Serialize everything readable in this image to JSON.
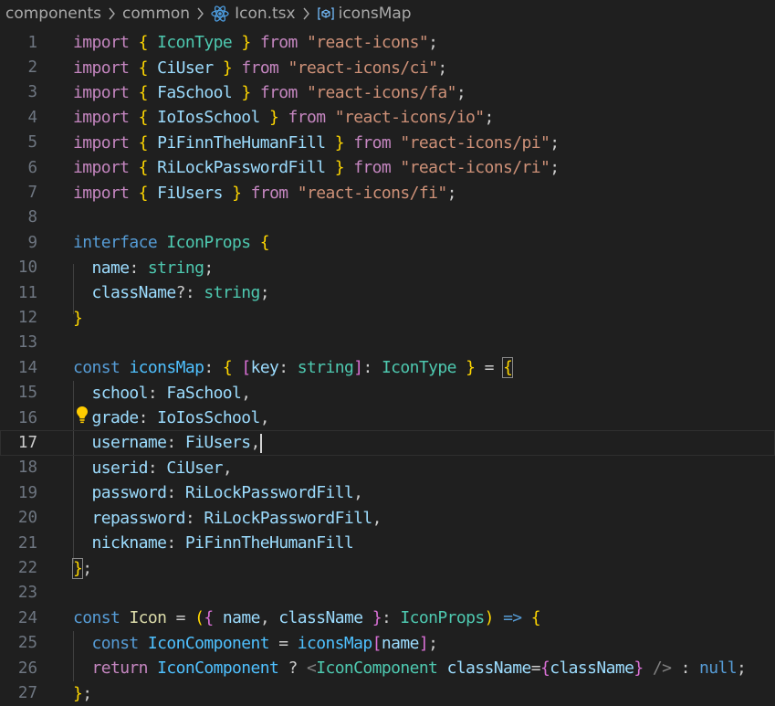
{
  "breadcrumb": {
    "items": [
      "components",
      "common",
      "Icon.tsx",
      "iconsMap"
    ]
  },
  "icons": {
    "file_icon": "react-icon",
    "symbol_icon": "symbol-variable-icon",
    "lightbulb_icon": "lightbulb-icon",
    "chevron": "chevron-right-icon"
  },
  "colors": {
    "background": "#1f1f1f",
    "keyword": "#c586c0",
    "storage": "#569cd6",
    "type": "#4ec9b0",
    "variable": "#9cdcfe",
    "string": "#ce9178",
    "bracket_gold": "#ffd700",
    "bracket_purple": "#da70d6",
    "bracket_blue": "#179fff",
    "line_number": "#6e7681",
    "lightbulb": "#ffcc00"
  },
  "editor": {
    "active_line": 17,
    "lines": [
      {
        "n": "1",
        "tokens": [
          [
            "kw",
            "import"
          ],
          [
            "pn",
            " "
          ],
          [
            "br1",
            "{"
          ],
          [
            "pn",
            " "
          ],
          [
            "ty",
            "IconType"
          ],
          [
            "pn",
            " "
          ],
          [
            "br1",
            "}"
          ],
          [
            "pn",
            " "
          ],
          [
            "kw",
            "from"
          ],
          [
            "pn",
            " "
          ],
          [
            "st",
            "\"react-icons\""
          ],
          [
            "pn",
            ";"
          ]
        ]
      },
      {
        "n": "2",
        "tokens": [
          [
            "kw",
            "import"
          ],
          [
            "pn",
            " "
          ],
          [
            "br1",
            "{"
          ],
          [
            "pn",
            " "
          ],
          [
            "vr",
            "CiUser"
          ],
          [
            "pn",
            " "
          ],
          [
            "br1",
            "}"
          ],
          [
            "pn",
            " "
          ],
          [
            "kw",
            "from"
          ],
          [
            "pn",
            " "
          ],
          [
            "st",
            "\"react-icons/ci\""
          ],
          [
            "pn",
            ";"
          ]
        ]
      },
      {
        "n": "3",
        "tokens": [
          [
            "kw",
            "import"
          ],
          [
            "pn",
            " "
          ],
          [
            "br1",
            "{"
          ],
          [
            "pn",
            " "
          ],
          [
            "vr",
            "FaSchool"
          ],
          [
            "pn",
            " "
          ],
          [
            "br1",
            "}"
          ],
          [
            "pn",
            " "
          ],
          [
            "kw",
            "from"
          ],
          [
            "pn",
            " "
          ],
          [
            "st",
            "\"react-icons/fa\""
          ],
          [
            "pn",
            ";"
          ]
        ]
      },
      {
        "n": "4",
        "tokens": [
          [
            "kw",
            "import"
          ],
          [
            "pn",
            " "
          ],
          [
            "br1",
            "{"
          ],
          [
            "pn",
            " "
          ],
          [
            "vr",
            "IoIosSchool"
          ],
          [
            "pn",
            " "
          ],
          [
            "br1",
            "}"
          ],
          [
            "pn",
            " "
          ],
          [
            "kw",
            "from"
          ],
          [
            "pn",
            " "
          ],
          [
            "st",
            "\"react-icons/io\""
          ],
          [
            "pn",
            ";"
          ]
        ]
      },
      {
        "n": "5",
        "tokens": [
          [
            "kw",
            "import"
          ],
          [
            "pn",
            " "
          ],
          [
            "br1",
            "{"
          ],
          [
            "pn",
            " "
          ],
          [
            "vr",
            "PiFinnTheHumanFill"
          ],
          [
            "pn",
            " "
          ],
          [
            "br1",
            "}"
          ],
          [
            "pn",
            " "
          ],
          [
            "kw",
            "from"
          ],
          [
            "pn",
            " "
          ],
          [
            "st",
            "\"react-icons/pi\""
          ],
          [
            "pn",
            ";"
          ]
        ]
      },
      {
        "n": "6",
        "tokens": [
          [
            "kw",
            "import"
          ],
          [
            "pn",
            " "
          ],
          [
            "br1",
            "{"
          ],
          [
            "pn",
            " "
          ],
          [
            "vr",
            "RiLockPasswordFill"
          ],
          [
            "pn",
            " "
          ],
          [
            "br1",
            "}"
          ],
          [
            "pn",
            " "
          ],
          [
            "kw",
            "from"
          ],
          [
            "pn",
            " "
          ],
          [
            "st",
            "\"react-icons/ri\""
          ],
          [
            "pn",
            ";"
          ]
        ]
      },
      {
        "n": "7",
        "tokens": [
          [
            "kw",
            "import"
          ],
          [
            "pn",
            " "
          ],
          [
            "br1",
            "{"
          ],
          [
            "pn",
            " "
          ],
          [
            "vr",
            "FiUsers"
          ],
          [
            "pn",
            " "
          ],
          [
            "br1",
            "}"
          ],
          [
            "pn",
            " "
          ],
          [
            "kw",
            "from"
          ],
          [
            "pn",
            " "
          ],
          [
            "st",
            "\"react-icons/fi\""
          ],
          [
            "pn",
            ";"
          ]
        ]
      },
      {
        "n": "8",
        "tokens": []
      },
      {
        "n": "9",
        "tokens": [
          [
            "kwb",
            "interface"
          ],
          [
            "pn",
            " "
          ],
          [
            "ty",
            "IconProps"
          ],
          [
            "pn",
            " "
          ],
          [
            "br1",
            "{"
          ]
        ]
      },
      {
        "n": "10",
        "tokens": [
          [
            "pn",
            "  "
          ],
          [
            "vr",
            "name"
          ],
          [
            "pn",
            ": "
          ],
          [
            "ty",
            "string"
          ],
          [
            "pn",
            ";"
          ]
        ]
      },
      {
        "n": "11",
        "tokens": [
          [
            "pn",
            "  "
          ],
          [
            "vr",
            "className"
          ],
          [
            "pn",
            "?: "
          ],
          [
            "ty",
            "string"
          ],
          [
            "pn",
            ";"
          ]
        ]
      },
      {
        "n": "12",
        "tokens": [
          [
            "br1",
            "}"
          ]
        ]
      },
      {
        "n": "13",
        "tokens": []
      },
      {
        "n": "14",
        "tokens": [
          [
            "kwb",
            "const"
          ],
          [
            "pn",
            " "
          ],
          [
            "cn",
            "iconsMap"
          ],
          [
            "pn",
            ": "
          ],
          [
            "br1",
            "{"
          ],
          [
            "pn",
            " "
          ],
          [
            "br2",
            "["
          ],
          [
            "vr",
            "key"
          ],
          [
            "pn",
            ": "
          ],
          [
            "ty",
            "string"
          ],
          [
            "br2",
            "]"
          ],
          [
            "pn",
            ": "
          ],
          [
            "ty",
            "IconType"
          ],
          [
            "pn",
            " "
          ],
          [
            "br1",
            "}"
          ],
          [
            "pn",
            " = "
          ],
          [
            "br1m",
            "{"
          ]
        ]
      },
      {
        "n": "15",
        "tokens": [
          [
            "pn",
            "  "
          ],
          [
            "vr",
            "school"
          ],
          [
            "pn",
            ": "
          ],
          [
            "vr",
            "FaSchool"
          ],
          [
            "pn",
            ","
          ]
        ]
      },
      {
        "n": "16",
        "tokens": [
          [
            "pn",
            "  "
          ],
          [
            "vr",
            "grade"
          ],
          [
            "pn",
            ": "
          ],
          [
            "vr",
            "IoIosSchool"
          ],
          [
            "pn",
            ","
          ]
        ]
      },
      {
        "n": "17",
        "tokens": [
          [
            "pn",
            "  "
          ],
          [
            "vr",
            "username"
          ],
          [
            "pn",
            ": "
          ],
          [
            "vr",
            "FiUsers"
          ],
          [
            "pn",
            ","
          ],
          [
            "cursor",
            ""
          ]
        ]
      },
      {
        "n": "18",
        "tokens": [
          [
            "pn",
            "  "
          ],
          [
            "vr",
            "userid"
          ],
          [
            "pn",
            ": "
          ],
          [
            "vr",
            "CiUser"
          ],
          [
            "pn",
            ","
          ]
        ]
      },
      {
        "n": "19",
        "tokens": [
          [
            "pn",
            "  "
          ],
          [
            "vr",
            "password"
          ],
          [
            "pn",
            ": "
          ],
          [
            "vr",
            "RiLockPasswordFill"
          ],
          [
            "pn",
            ","
          ]
        ]
      },
      {
        "n": "20",
        "tokens": [
          [
            "pn",
            "  "
          ],
          [
            "vr",
            "repassword"
          ],
          [
            "pn",
            ": "
          ],
          [
            "vr",
            "RiLockPasswordFill"
          ],
          [
            "pn",
            ","
          ]
        ]
      },
      {
        "n": "21",
        "tokens": [
          [
            "pn",
            "  "
          ],
          [
            "vr",
            "nickname"
          ],
          [
            "pn",
            ": "
          ],
          [
            "vr",
            "PiFinnTheHumanFill"
          ]
        ]
      },
      {
        "n": "22",
        "tokens": [
          [
            "br1m",
            "}"
          ],
          [
            "pn",
            ";"
          ]
        ]
      },
      {
        "n": "23",
        "tokens": []
      },
      {
        "n": "24",
        "tokens": [
          [
            "kwb",
            "const"
          ],
          [
            "pn",
            " "
          ],
          [
            "fn",
            "Icon"
          ],
          [
            "pn",
            " = "
          ],
          [
            "br1",
            "("
          ],
          [
            "br2",
            "{"
          ],
          [
            "pn",
            " "
          ],
          [
            "vr",
            "name"
          ],
          [
            "pn",
            ", "
          ],
          [
            "vr",
            "className"
          ],
          [
            "pn",
            " "
          ],
          [
            "br2",
            "}"
          ],
          [
            "pn",
            ": "
          ],
          [
            "ty",
            "IconProps"
          ],
          [
            "br1",
            ")"
          ],
          [
            "pn",
            " "
          ],
          [
            "kwb",
            "=>"
          ],
          [
            "pn",
            " "
          ],
          [
            "br1",
            "{"
          ]
        ]
      },
      {
        "n": "25",
        "tokens": [
          [
            "pn",
            "  "
          ],
          [
            "kwb",
            "const"
          ],
          [
            "pn",
            " "
          ],
          [
            "cn",
            "IconComponent"
          ],
          [
            "pn",
            " = "
          ],
          [
            "cn",
            "iconsMap"
          ],
          [
            "br2",
            "["
          ],
          [
            "vr",
            "name"
          ],
          [
            "br2",
            "]"
          ],
          [
            "pn",
            ";"
          ]
        ]
      },
      {
        "n": "26",
        "tokens": [
          [
            "pn",
            "  "
          ],
          [
            "kw",
            "return"
          ],
          [
            "pn",
            " "
          ],
          [
            "cn",
            "IconComponent"
          ],
          [
            "pn",
            " ? "
          ],
          [
            "tg",
            "<"
          ],
          [
            "ty",
            "IconComponent"
          ],
          [
            "pn",
            " "
          ],
          [
            "vr",
            "className"
          ],
          [
            "pn",
            "="
          ],
          [
            "br2",
            "{"
          ],
          [
            "vr",
            "className"
          ],
          [
            "br2",
            "}"
          ],
          [
            "pn",
            " "
          ],
          [
            "tg",
            "/>"
          ],
          [
            "pn",
            " : "
          ],
          [
            "kwb",
            "null"
          ],
          [
            "pn",
            ";"
          ]
        ]
      },
      {
        "n": "27",
        "tokens": [
          [
            "br1",
            "}"
          ],
          [
            "pn",
            ";"
          ]
        ]
      }
    ]
  }
}
